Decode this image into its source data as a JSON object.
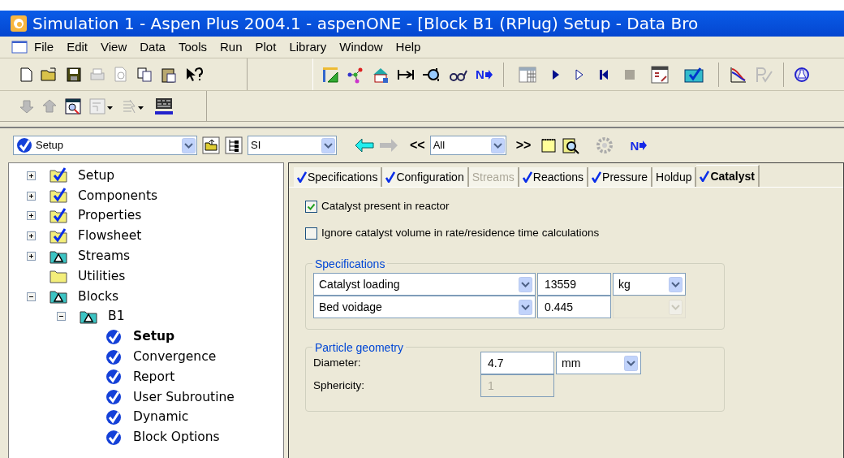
{
  "window": {
    "title": "Simulation 1 - Aspen Plus 2004.1 - aspenONE - [Block B1 (RPlug) Setup - Data Bro"
  },
  "menu": [
    "File",
    "Edit",
    "View",
    "Data",
    "Tools",
    "Run",
    "Plot",
    "Library",
    "Window",
    "Help"
  ],
  "toolbar": {
    "next_label": "N"
  },
  "navigator": {
    "folder": "Setup",
    "units": "SI",
    "back": "<<",
    "filter": "All",
    "forward": ">>",
    "next_label": "N"
  },
  "tree": [
    {
      "label": "Setup",
      "kind": "complete",
      "expanded": false,
      "selected": false
    },
    {
      "label": "Components",
      "kind": "complete",
      "expanded": false,
      "selected": false
    },
    {
      "label": "Properties",
      "kind": "complete",
      "expanded": false,
      "selected": false
    },
    {
      "label": "Flowsheet",
      "kind": "complete",
      "expanded": false,
      "selected": false
    },
    {
      "label": "Streams",
      "kind": "warning",
      "expanded": false,
      "selected": false
    },
    {
      "label": "Utilities",
      "kind": "empty",
      "selected": false
    },
    {
      "label": "Blocks",
      "kind": "warning",
      "expanded": true,
      "selected": false,
      "children": [
        {
          "label": "B1",
          "kind": "warning",
          "expanded": true,
          "selected": false,
          "children": [
            {
              "label": "Setup",
              "kind": "form",
              "selected": true
            },
            {
              "label": "Convergence",
              "kind": "form",
              "selected": false
            },
            {
              "label": "Report",
              "kind": "form",
              "selected": false
            },
            {
              "label": "User Subroutine",
              "kind": "form",
              "selected": false
            },
            {
              "label": "Dynamic",
              "kind": "form",
              "selected": false
            },
            {
              "label": "Block Options",
              "kind": "form",
              "selected": false
            }
          ]
        }
      ]
    }
  ],
  "tabs": [
    {
      "label": "Specifications",
      "complete": true,
      "disabled": false,
      "selected": false
    },
    {
      "label": "Configuration",
      "complete": true,
      "disabled": false,
      "selected": false
    },
    {
      "label": "Streams",
      "complete": false,
      "disabled": true,
      "selected": false
    },
    {
      "label": "Reactions",
      "complete": true,
      "disabled": false,
      "selected": false
    },
    {
      "label": "Pressure",
      "complete": true,
      "disabled": false,
      "selected": false
    },
    {
      "label": "Holdup",
      "complete": false,
      "disabled": false,
      "selected": false
    },
    {
      "label": "Catalyst",
      "complete": true,
      "disabled": false,
      "selected": true
    }
  ],
  "options": [
    {
      "label": "Catalyst present in reactor",
      "checked": true
    },
    {
      "label": "Ignore catalyst volume in rate/residence time calculations",
      "checked": false
    }
  ],
  "specifications": {
    "title": "Specifications",
    "rows": [
      {
        "option": "Catalyst loading",
        "value": "13559",
        "unit": "kg",
        "unit_disabled": false
      },
      {
        "option": "Bed voidage",
        "value": "0.445",
        "unit_disabled": true
      }
    ]
  },
  "particle_geometry": {
    "title": "Particle geometry",
    "fields": [
      {
        "label": "Diameter:",
        "value": "4.7",
        "unit": "mm",
        "disabled": false
      },
      {
        "label": "Sphericity:",
        "value": "1",
        "disabled": true
      }
    ]
  }
}
